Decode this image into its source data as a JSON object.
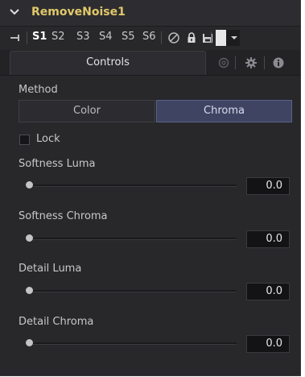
{
  "node": {
    "title": "RemoveNoise1"
  },
  "toolbar": {
    "slots": [
      "S1",
      "S2",
      "S3",
      "S4",
      "S5",
      "S6"
    ],
    "active_slot": "S1"
  },
  "tabs": {
    "controls_label": "Controls"
  },
  "controls": {
    "method": {
      "label": "Method",
      "options": [
        "Color",
        "Chroma"
      ],
      "selected": "Chroma"
    },
    "lock": {
      "label": "Lock",
      "checked": false
    },
    "sliders": [
      {
        "label": "Softness Luma",
        "value": "0.0"
      },
      {
        "label": "Softness Chroma",
        "value": "0.0"
      },
      {
        "label": "Detail Luma",
        "value": "0.0"
      },
      {
        "label": "Detail Chroma",
        "value": "0.0"
      }
    ]
  },
  "colors": {
    "title": "#e2c86a",
    "selected_button": "#3f4463",
    "panel_bg": "#28282b"
  },
  "icons": {
    "collapse": "chevron-down-icon",
    "pin": "pin-icon",
    "disable": "disable-icon",
    "lock": "lock-icon",
    "save": "save-icon",
    "color_swatch": "color-swatch-icon",
    "tab_2": "spline-icon",
    "tab_3": "gear-icon",
    "tab_4": "info-icon"
  }
}
